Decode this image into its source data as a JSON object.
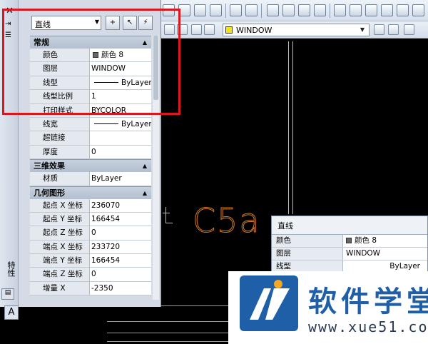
{
  "palette": {
    "object_type": "直线",
    "title": "特性",
    "sections": [
      {
        "name": "常规",
        "rows": [
          {
            "key": "颜色",
            "value": "颜色 8",
            "swatch": "#666666"
          },
          {
            "key": "图层",
            "value": "WINDOW"
          },
          {
            "key": "线型",
            "value": "ByLayer",
            "line": true
          },
          {
            "key": "线型比例",
            "value": "1"
          },
          {
            "key": "打印样式",
            "value": "BYCOLOR"
          },
          {
            "key": "线宽",
            "value": "ByLayer",
            "line": true
          },
          {
            "key": "超链接",
            "value": ""
          },
          {
            "key": "厚度",
            "value": "0"
          }
        ]
      },
      {
        "name": "三维效果",
        "rows": [
          {
            "key": "材质",
            "value": "ByLayer"
          }
        ]
      },
      {
        "name": "几何图形",
        "rows": [
          {
            "key": "起点 X 坐标",
            "value": "236070"
          },
          {
            "key": "起点 Y 坐标",
            "value": "166454"
          },
          {
            "key": "起点 Z 坐标",
            "value": "0"
          },
          {
            "key": "端点 X 坐标",
            "value": "233720"
          },
          {
            "key": "端点 Y 坐标",
            "value": "166454"
          },
          {
            "key": "端点 Z 坐标",
            "value": "0"
          },
          {
            "key": "增量 X",
            "value": "-2350"
          }
        ]
      }
    ]
  },
  "layer_toolbar": {
    "current_layer": "WINDOW",
    "layer_color": "#f2e21d"
  },
  "drawing": {
    "label": "C5a",
    "label_color": "#d97a1f"
  },
  "second_panel": {
    "object_type": "直线",
    "rows": [
      {
        "key": "颜色",
        "value": "颜色 8"
      },
      {
        "key": "图层",
        "value": "WINDOW"
      },
      {
        "key": "线型",
        "value": "ByLayer"
      }
    ]
  },
  "watermark": {
    "text": "软件学堂",
    "url": "www.xue51.com"
  },
  "highlight_color": "#d9171e"
}
